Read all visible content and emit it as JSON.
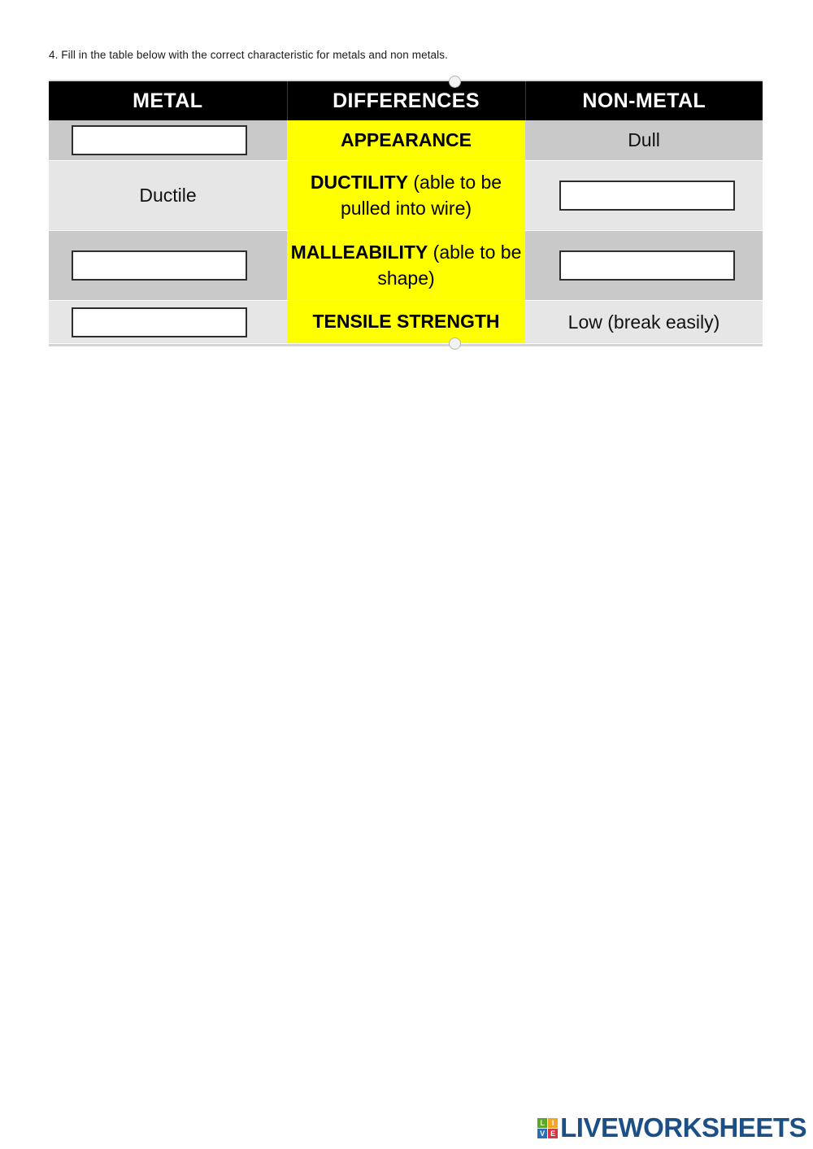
{
  "question": {
    "text": "4. Fill in the table below with the correct characteristic for metals and non metals."
  },
  "table": {
    "headers": {
      "metal": "METAL",
      "differences": "DIFFERENCES",
      "non_metal": "NON-METAL"
    },
    "rows": [
      {
        "metal": {
          "type": "input",
          "value": "",
          "placeholder": ""
        },
        "differences": {
          "bold": "APPEARANCE",
          "rest": ""
        },
        "non_metal": {
          "type": "text",
          "value": "Dull"
        }
      },
      {
        "metal": {
          "type": "text",
          "value": "Ductile"
        },
        "differences": {
          "bold": "DUCTILITY",
          "rest": " (able to be pulled into wire)"
        },
        "non_metal": {
          "type": "input",
          "value": "",
          "placeholder": ""
        }
      },
      {
        "metal": {
          "type": "input",
          "value": "",
          "placeholder": ""
        },
        "differences": {
          "bold": "MALLEABILITY",
          "rest": " (able to be shape)"
        },
        "non_metal": {
          "type": "input",
          "value": "",
          "placeholder": ""
        }
      },
      {
        "metal": {
          "type": "input",
          "value": "",
          "placeholder": ""
        },
        "differences": {
          "bold": "TENSILE STRENGTH",
          "rest": ""
        },
        "non_metal": {
          "type": "text",
          "value": "Low (break easily)"
        }
      }
    ]
  },
  "footer": {
    "logo_letters": [
      "L",
      "I",
      "V",
      "E"
    ],
    "brand": "LIVEWORKSHEETS"
  },
  "colors": {
    "header_bg": "#000000",
    "header_text": "#ffffff",
    "highlight": "#ffff00",
    "row_shade_dark": "#c9c9c9",
    "row_shade_light": "#e6e6e6",
    "brand_blue": "#1b4f86",
    "logo_green": "#5aa829",
    "logo_orange": "#f2a625",
    "logo_blue": "#2a6ebb",
    "logo_red": "#d9333f"
  }
}
